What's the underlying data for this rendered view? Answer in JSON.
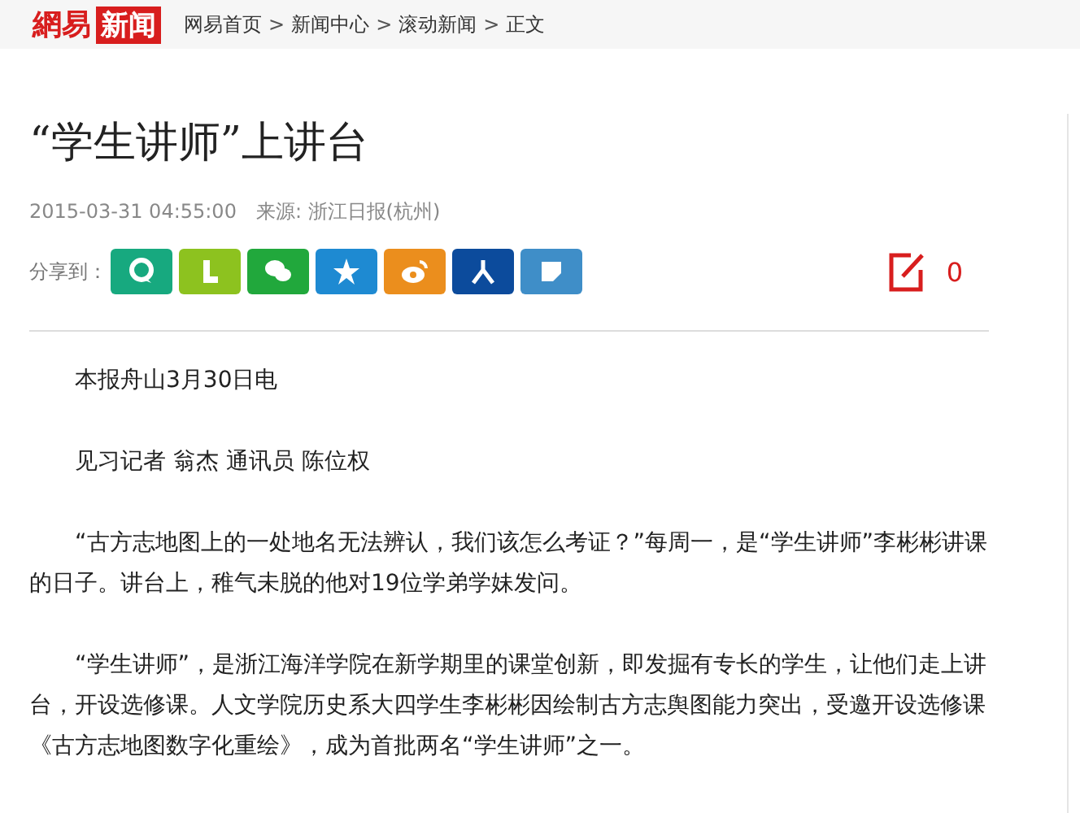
{
  "header": {
    "logo_main": "網易",
    "logo_badge": "新闻",
    "separator": ">",
    "breadcrumbs": [
      "网易首页",
      "新闻中心",
      "滚动新闻",
      "正文"
    ]
  },
  "article": {
    "title": "“学生讲师”上讲台",
    "date": "2015-03-31 04:55:00",
    "source": "来源: 浙江日报(杭州)",
    "share_label": "分享到：",
    "share_buttons": [
      {
        "kind": "qzone",
        "color": "#17a97f"
      },
      {
        "kind": "laiwang",
        "color": "#8dc21f"
      },
      {
        "kind": "wechat",
        "color": "#21a83c"
      },
      {
        "kind": "tqq",
        "color": "#1e8ad2"
      },
      {
        "kind": "weibo",
        "color": "#eb8e1d"
      },
      {
        "kind": "renren",
        "color": "#0c4b9c"
      },
      {
        "kind": "note",
        "color": "#3f8ec8"
      }
    ],
    "comment_count": "0",
    "paragraphs": [
      "本报舟山3月30日电",
      "见习记者 翁杰 通讯员 陈位权",
      "“古方志地图上的一处地名无法辨认，我们该怎么考证？”每周一，是“学生讲师”李彬彬讲课的日子。讲台上，稚气未脱的他对19位学弟学妹发问。",
      "“学生讲师”，是浙江海洋学院在新学期里的课堂创新，即发掘有专长的学生，让他们走上讲台，开设选修课。人文学院历史系大四学生李彬彬因绘制古方志舆图能力突出，受邀开设选修课《古方志地图数字化重绘》，成为首批两名“学生讲师”之一。"
    ]
  }
}
